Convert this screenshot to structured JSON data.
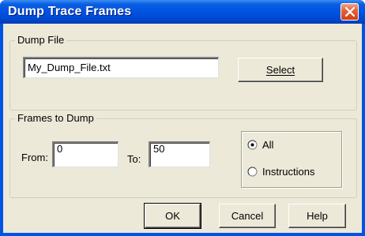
{
  "dialog": {
    "title": "Dump Trace Frames",
    "close_icon": "close-icon"
  },
  "dump_file": {
    "legend": "Dump File",
    "file_value": "My_Dump_File.txt",
    "select_label": "Select"
  },
  "frames": {
    "legend": "Frames to Dump",
    "from_label": "From:",
    "from_value": "0",
    "to_label": "To:",
    "to_value": "50",
    "options": [
      {
        "label": "All",
        "selected": true
      },
      {
        "label": "Instructions",
        "selected": false
      }
    ]
  },
  "buttons": {
    "ok": "OK",
    "cancel": "Cancel",
    "help": "Help"
  }
}
